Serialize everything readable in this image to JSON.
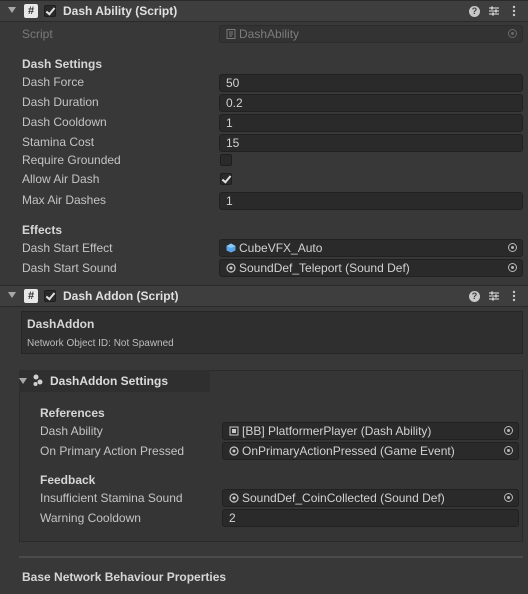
{
  "dash_ability": {
    "title": "Dash Ability (Script)",
    "script_label": "Script",
    "script_value": "DashAbility",
    "settings_header": "Dash Settings",
    "fields": [
      {
        "label": "Dash Force",
        "value": "50"
      },
      {
        "label": "Dash Duration",
        "value": "0.2"
      },
      {
        "label": "Dash Cooldown",
        "value": "1"
      },
      {
        "label": "Stamina Cost",
        "value": "15"
      }
    ],
    "require_grounded": {
      "label": "Require Grounded",
      "checked": false
    },
    "allow_air_dash": {
      "label": "Allow Air Dash",
      "checked": true
    },
    "max_air_dashes": {
      "label": "Max Air Dashes",
      "value": "1"
    },
    "effects_header": "Effects",
    "dash_start_effect": {
      "label": "Dash Start Effect",
      "value": "CubeVFX_Auto"
    },
    "dash_start_sound": {
      "label": "Dash Start Sound",
      "value": "SoundDef_Teleport (Sound Def)"
    }
  },
  "dash_addon": {
    "title": "Dash Addon (Script)",
    "info_title": "DashAddon",
    "info_network": "Network Object ID: Not Spawned",
    "settings_title": "DashAddon Settings",
    "references_header": "References",
    "dash_ability": {
      "label": "Dash Ability",
      "value": "[BB] PlatformerPlayer (Dash Ability)"
    },
    "on_primary": {
      "label": "On Primary Action Pressed",
      "value": "OnPrimaryActionPressed (Game Event)"
    },
    "feedback_header": "Feedback",
    "insufficient": {
      "label": "Insufficient Stamina Sound",
      "value": "SoundDef_CoinCollected (Sound Def)"
    },
    "warning_cooldown": {
      "label": "Warning Cooldown",
      "value": "2"
    },
    "base_network": "Base Network Behaviour Properties"
  },
  "icons": [
    "fold-arrow-icon",
    "script-icon",
    "help-icon",
    "presets-icon",
    "more-menu-icon",
    "object-picker-icon",
    "cube-icon",
    "sound-def-icon",
    "prefab-icon",
    "settings-icon"
  ]
}
